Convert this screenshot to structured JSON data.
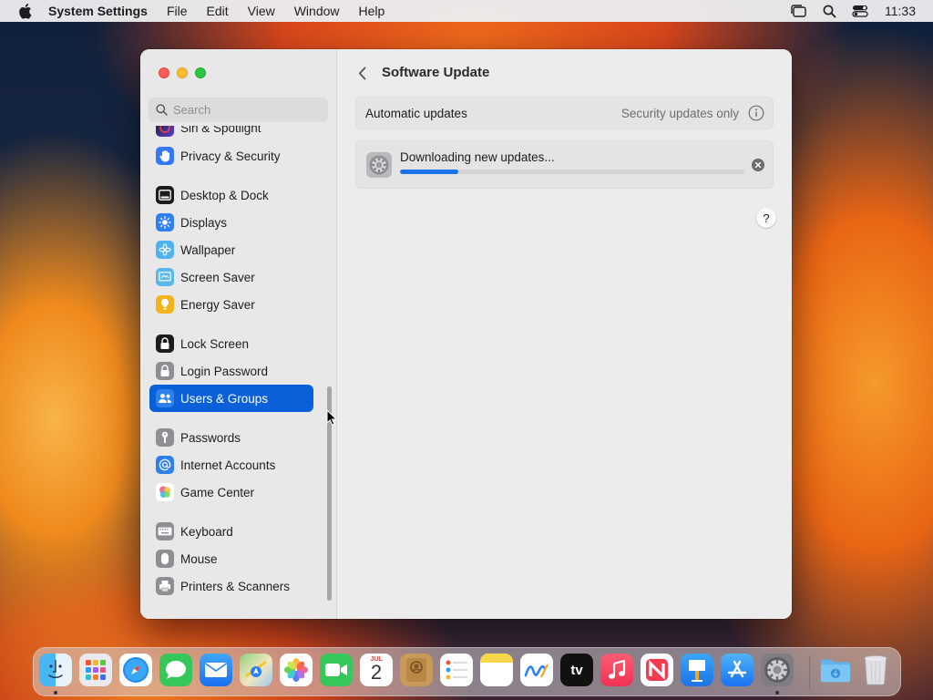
{
  "menubar": {
    "app_name": "System Settings",
    "menus": [
      "File",
      "Edit",
      "View",
      "Window",
      "Help"
    ],
    "clock": "11:33"
  },
  "window": {
    "search_placeholder": "Search",
    "sidebar": {
      "items": [
        {
          "label": "Siri & Spotlight",
          "icon": "siri-icon",
          "color": "#5b3fd0"
        },
        {
          "label": "Privacy & Security",
          "icon": "hand-icon",
          "color": "#3478f6"
        },
        {
          "label": "Desktop & Dock",
          "icon": "dock-icon",
          "color": "#1c1c1e"
        },
        {
          "label": "Displays",
          "icon": "sun-icon",
          "color": "#2f80ed"
        },
        {
          "label": "Wallpaper",
          "icon": "flower-icon",
          "color": "#4fb3f0"
        },
        {
          "label": "Screen Saver",
          "icon": "screen-saver-icon",
          "color": "#5ab8e8"
        },
        {
          "label": "Energy Saver",
          "icon": "bulb-icon",
          "color": "#f5b31b"
        },
        {
          "label": "Lock Screen",
          "icon": "lock-icon",
          "color": "#1c1c1e"
        },
        {
          "label": "Login Password",
          "icon": "lock-icon",
          "color": "#8e8e93"
        },
        {
          "label": "Users & Groups",
          "icon": "users-icon",
          "color": "#2f80ed",
          "selected": true
        },
        {
          "label": "Passwords",
          "icon": "key-icon",
          "color": "#8e8e93"
        },
        {
          "label": "Internet Accounts",
          "icon": "at-icon",
          "color": "#2f80ed"
        },
        {
          "label": "Game Center",
          "icon": "game-center-icon",
          "color": "#ffffff"
        },
        {
          "label": "Keyboard",
          "icon": "keyboard-icon",
          "color": "#8e8e93"
        },
        {
          "label": "Mouse",
          "icon": "mouse-icon",
          "color": "#8e8e93"
        },
        {
          "label": "Printers & Scanners",
          "icon": "printer-icon",
          "color": "#8e8e93"
        }
      ]
    },
    "content": {
      "title": "Software Update",
      "automatic_updates": {
        "label": "Automatic updates",
        "value": "Security updates only"
      },
      "download": {
        "text": "Downloading new updates...",
        "progress": 0.17
      },
      "help_label": "?"
    }
  },
  "dock": {
    "apps": [
      {
        "name": "finder-icon",
        "running": true
      },
      {
        "name": "launchpad-icon"
      },
      {
        "name": "safari-icon"
      },
      {
        "name": "messages-icon"
      },
      {
        "name": "mail-icon"
      },
      {
        "name": "maps-icon"
      },
      {
        "name": "photos-icon"
      },
      {
        "name": "facetime-icon"
      },
      {
        "name": "calendar-icon",
        "month": "JUL",
        "day": "2"
      },
      {
        "name": "contacts-icon"
      },
      {
        "name": "reminders-icon"
      },
      {
        "name": "notes-icon"
      },
      {
        "name": "freeform-icon"
      },
      {
        "name": "tv-icon",
        "label": "tv"
      },
      {
        "name": "music-icon"
      },
      {
        "name": "news-icon"
      },
      {
        "name": "keynote-icon"
      },
      {
        "name": "app-store-icon"
      },
      {
        "name": "system-settings-icon",
        "running": true
      },
      {
        "name": "downloads-folder-icon"
      },
      {
        "name": "trash-icon"
      }
    ]
  }
}
